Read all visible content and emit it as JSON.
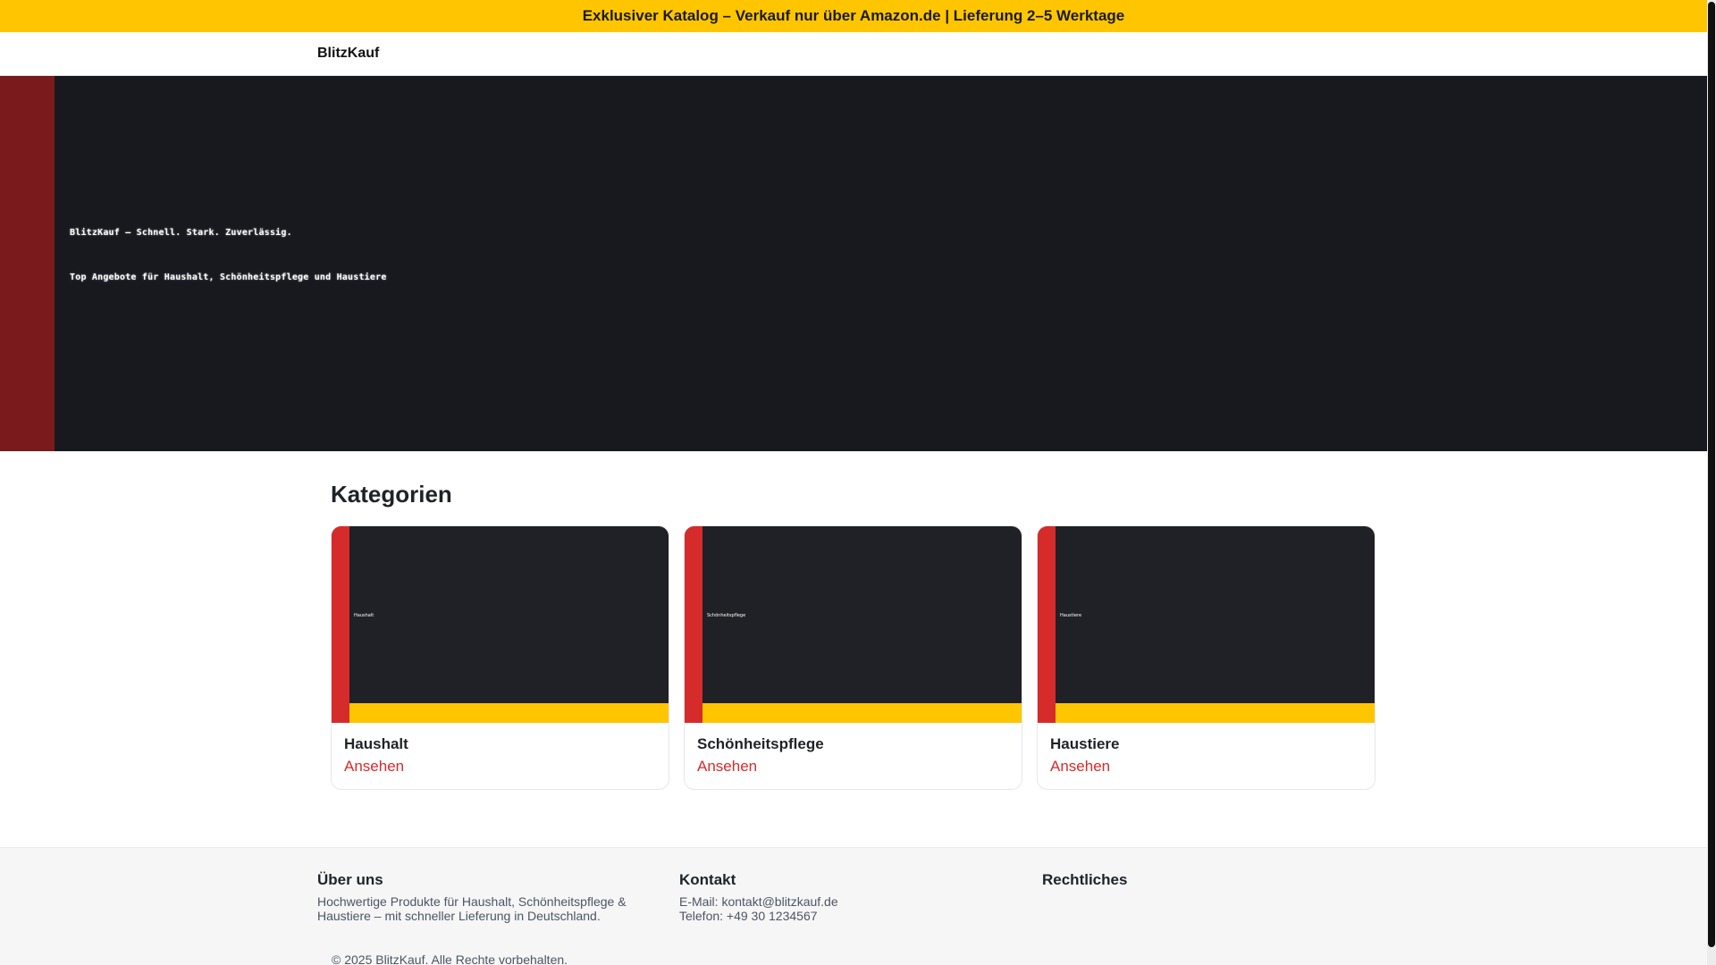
{
  "announcement": "Exklusiver Katalog – Verkauf nur über Amazon.de | Lieferung 2–5 Werktage",
  "nav": {
    "brand": "BlitzKauf"
  },
  "hero": {
    "line1": "BlitzKauf – Schnell. Stark. Zuverlässig.",
    "line2": "Top Angebote für Haushalt, Schönheitspflege und Haustiere"
  },
  "categories": {
    "title": "Kategorien",
    "items": [
      {
        "name": "Haushalt",
        "image_text": "Haushalt",
        "link": "Ansehen"
      },
      {
        "name": "Schönheitspflege",
        "image_text": "Schönheitspflege",
        "link": "Ansehen"
      },
      {
        "name": "Haustiere",
        "image_text": "Haustiere",
        "link": "Ansehen"
      }
    ]
  },
  "footer": {
    "about": {
      "title": "Über uns",
      "text": "Hochwertige Produkte für Haushalt, Schönheitspflege & Haustiere – mit schneller Lieferung in Deutschland."
    },
    "contact": {
      "title": "Kontakt",
      "email": "E-Mail: kontakt@blitzkauf.de",
      "phone": "Telefon: +49 30 1234567"
    },
    "legal": {
      "title": "Rechtliches"
    },
    "copyright": "© 2025 BlitzKauf. Alle Rechte vorbehalten."
  },
  "colors": {
    "accent_yellow": "#ffc600",
    "accent_red": "#d62b2b",
    "hero_stripe": "#7b1a1d",
    "hero_bg": "#17191e"
  }
}
